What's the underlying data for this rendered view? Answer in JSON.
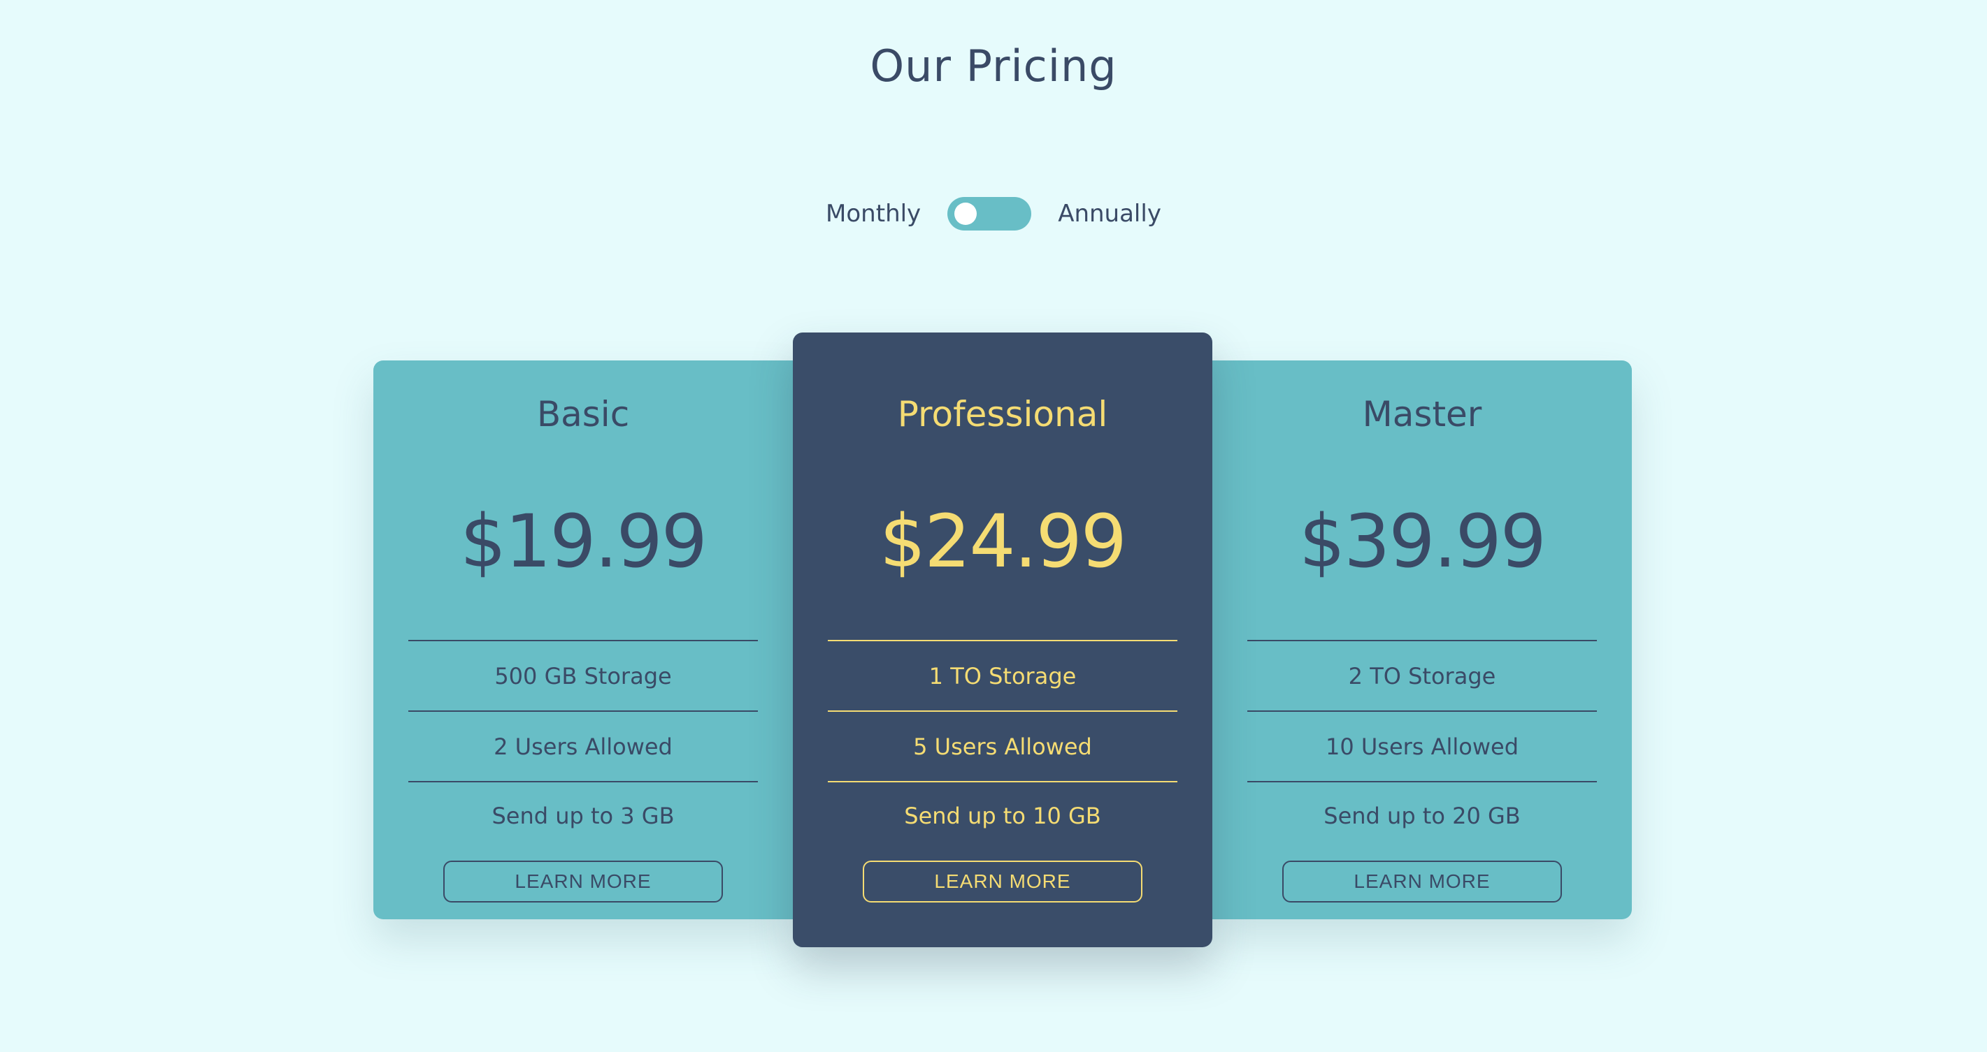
{
  "page": {
    "title": "Our Pricing"
  },
  "billing": {
    "monthly_label": "Monthly",
    "annually_label": "Annually",
    "selected": "Monthly"
  },
  "colors": {
    "background": "#e6fbfc",
    "card_teal": "#68bec6",
    "card_featured": "#3a4d69",
    "text_dark": "#3a4a66",
    "accent_yellow": "#f5dc73"
  },
  "plans": [
    {
      "name": "Basic",
      "price": "$19.99",
      "features": [
        "500 GB Storage",
        "2 Users Allowed",
        "Send up to 3 GB"
      ],
      "button_label": "LEARN MORE"
    },
    {
      "name": "Professional",
      "price": "$24.99",
      "features": [
        "1 TO Storage",
        "5 Users Allowed",
        "Send up to 10 GB"
      ],
      "button_label": "LEARN MORE"
    },
    {
      "name": "Master",
      "price": "$39.99",
      "features": [
        "2 TO Storage",
        "10 Users Allowed",
        "Send up to 20 GB"
      ],
      "button_label": "LEARN MORE"
    }
  ]
}
